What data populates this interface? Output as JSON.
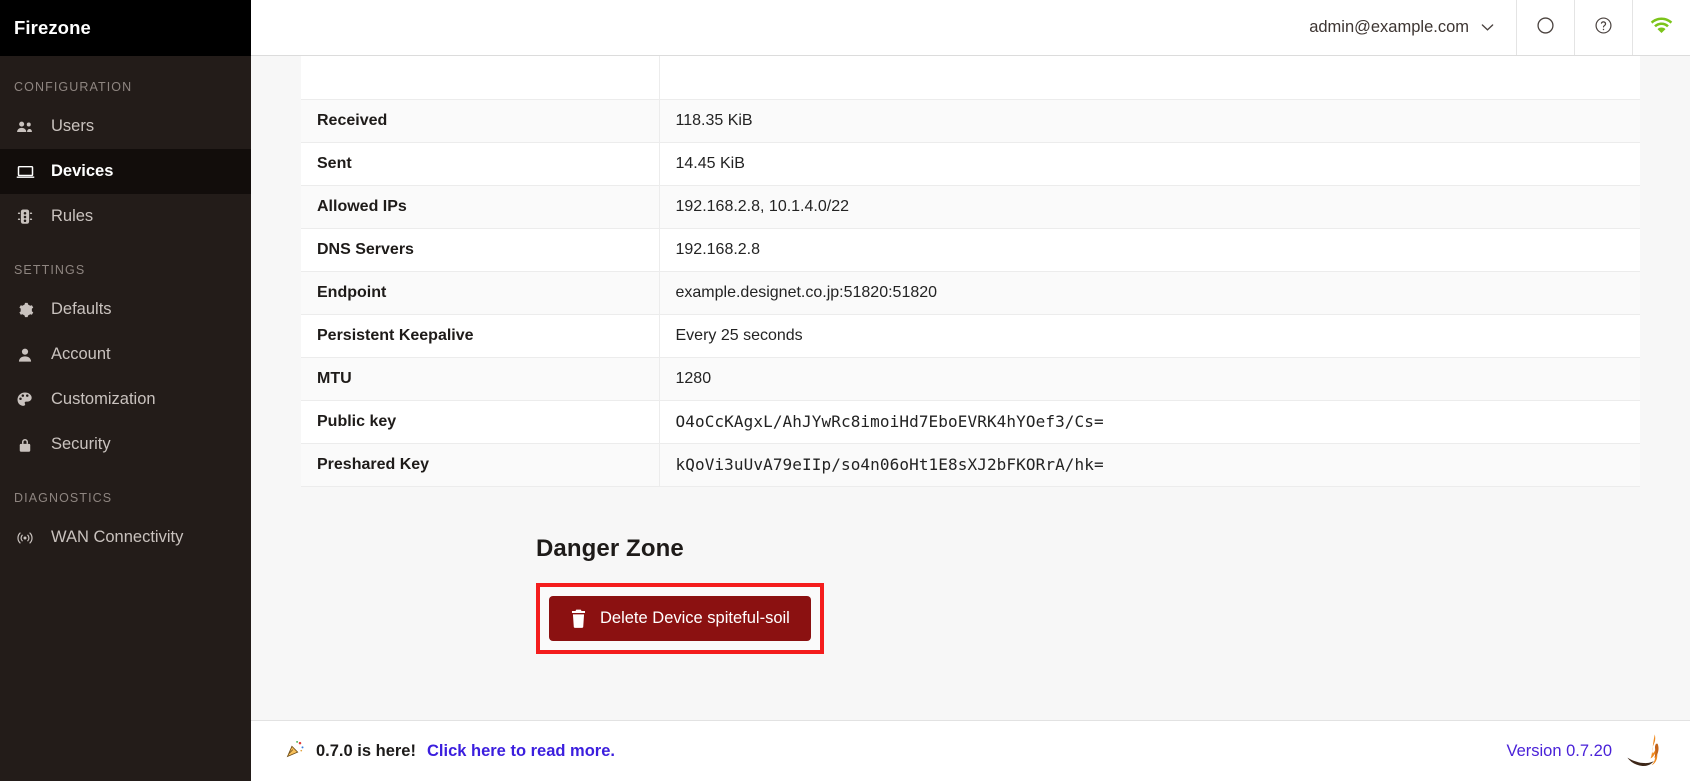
{
  "sidebar": {
    "brand": "Firezone",
    "sections": [
      {
        "label": "CONFIGURATION",
        "items": [
          {
            "label": "Users",
            "icon": "users-icon",
            "active": false
          },
          {
            "label": "Devices",
            "icon": "laptop-icon",
            "active": true
          },
          {
            "label": "Rules",
            "icon": "traffic-light-icon",
            "active": false
          }
        ]
      },
      {
        "label": "SETTINGS",
        "items": [
          {
            "label": "Defaults",
            "icon": "gear-icon",
            "active": false
          },
          {
            "label": "Account",
            "icon": "person-icon",
            "active": false
          },
          {
            "label": "Customization",
            "icon": "palette-icon",
            "active": false
          },
          {
            "label": "Security",
            "icon": "lock-icon",
            "active": false
          }
        ]
      },
      {
        "label": "DIAGNOSTICS",
        "items": [
          {
            "label": "WAN Connectivity",
            "icon": "broadcast-icon",
            "active": false
          }
        ]
      }
    ]
  },
  "topbar": {
    "user_email": "admin@example.com",
    "chevron": "⌄",
    "icons": [
      {
        "name": "circle-icon",
        "label": ""
      },
      {
        "name": "help-circle-icon",
        "label": ""
      },
      {
        "name": "wifi-icon",
        "label": "",
        "color": "#7cc41a"
      }
    ]
  },
  "detail_table": {
    "rows": [
      {
        "key": "Received",
        "value": "118.35 KiB",
        "mono": false
      },
      {
        "key": "Sent",
        "value": "14.45 KiB",
        "mono": false
      },
      {
        "key": "Allowed IPs",
        "value": "192.168.2.8, 10.1.4.0/22",
        "mono": false
      },
      {
        "key": "DNS Servers",
        "value": "192.168.2.8",
        "mono": false
      },
      {
        "key": "Endpoint",
        "value": "example.designet.co.jp:51820:51820",
        "mono": false
      },
      {
        "key": "Persistent Keepalive",
        "value": "Every 25 seconds",
        "mono": false
      },
      {
        "key": "MTU",
        "value": "1280",
        "mono": false
      },
      {
        "key": "Public key",
        "value": "O4oCcKAgxL/AhJYwRc8imoiHd7EboEVRK4hYOef3/Cs=",
        "mono": true
      },
      {
        "key": "Preshared Key",
        "value": "kQoVi3uUvA79eIIp/so4n06oHt1E8sXJ2bFKORrA/hk=",
        "mono": true
      }
    ]
  },
  "danger_zone": {
    "title": "Danger Zone",
    "delete_button_label": "Delete Device spiteful-soil",
    "delete_icon": "trash-icon",
    "highlight_color": "#f41d1d",
    "button_color": "#8b1111"
  },
  "footer": {
    "party_icon": "🎉",
    "announcement": "0.7.0 is here!",
    "link_text": "Click here to read more.",
    "version": "Version 0.7.20",
    "logo_icon": "firezone-flame-icon"
  }
}
